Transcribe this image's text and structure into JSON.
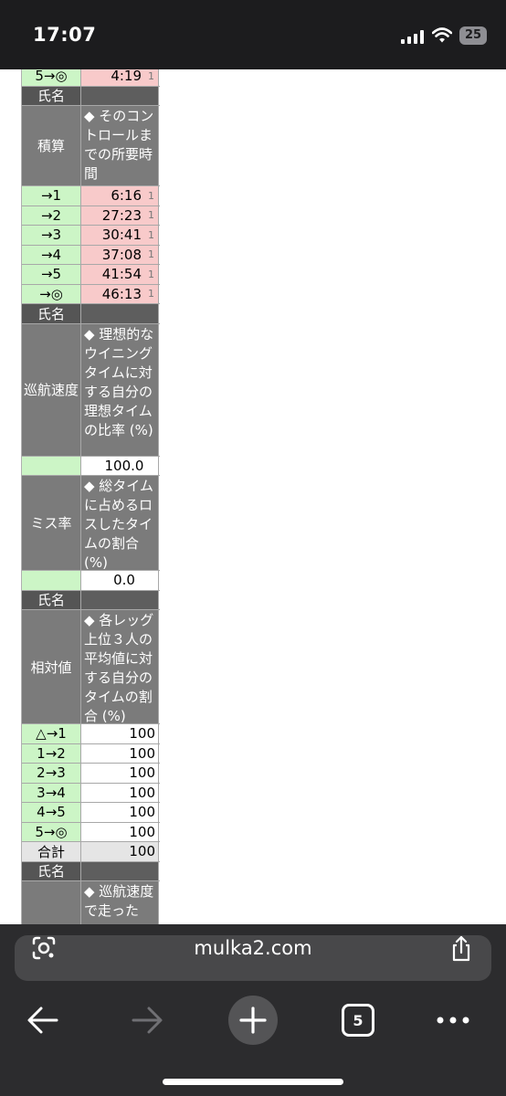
{
  "status_bar": {
    "time": "17:07",
    "battery": "25"
  },
  "browser": {
    "url": "mulka2.com",
    "tab_count": "5"
  },
  "table": {
    "top_row": {
      "label": "5→◎",
      "value": "4:19",
      "rank": "1"
    },
    "name_header": "氏名",
    "cumulative": {
      "label": "積算",
      "desc": "◆ そのコントロールまでの所要時間",
      "rows": [
        {
          "label": "→1",
          "value": "6:16",
          "rank": "1"
        },
        {
          "label": "→2",
          "value": "27:23",
          "rank": "1"
        },
        {
          "label": "→3",
          "value": "30:41",
          "rank": "1"
        },
        {
          "label": "→4",
          "value": "37:08",
          "rank": "1"
        },
        {
          "label": "→5",
          "value": "41:54",
          "rank": "1"
        },
        {
          "label": "→◎",
          "value": "46:13",
          "rank": "1"
        }
      ]
    },
    "cruise": {
      "label": "巡航速度",
      "desc": "◆ 理想的なウイニングタイムに対する自分の理想タイムの比率 (%)",
      "value": "100.0"
    },
    "miss": {
      "label": "ミス率",
      "desc": "◆ 総タイムに占めるロスしたタイムの割合 (%)",
      "value": "0.0"
    },
    "relative": {
      "label": "相対値",
      "desc": "◆ 各レッグ上位３人の平均値に対する自分のタイムの割合 (%)",
      "rows": [
        {
          "label": "△→1",
          "value": "100"
        },
        {
          "label": "1→2",
          "value": "100"
        },
        {
          "label": "2→3",
          "value": "100"
        },
        {
          "label": "3→4",
          "value": "100"
        },
        {
          "label": "4→5",
          "value": "100"
        },
        {
          "label": "5→◎",
          "value": "100"
        }
      ],
      "total_label": "合計",
      "total_value": "100"
    },
    "cruise_run": {
      "desc": "◆ 巡航速度で走った"
    }
  }
}
